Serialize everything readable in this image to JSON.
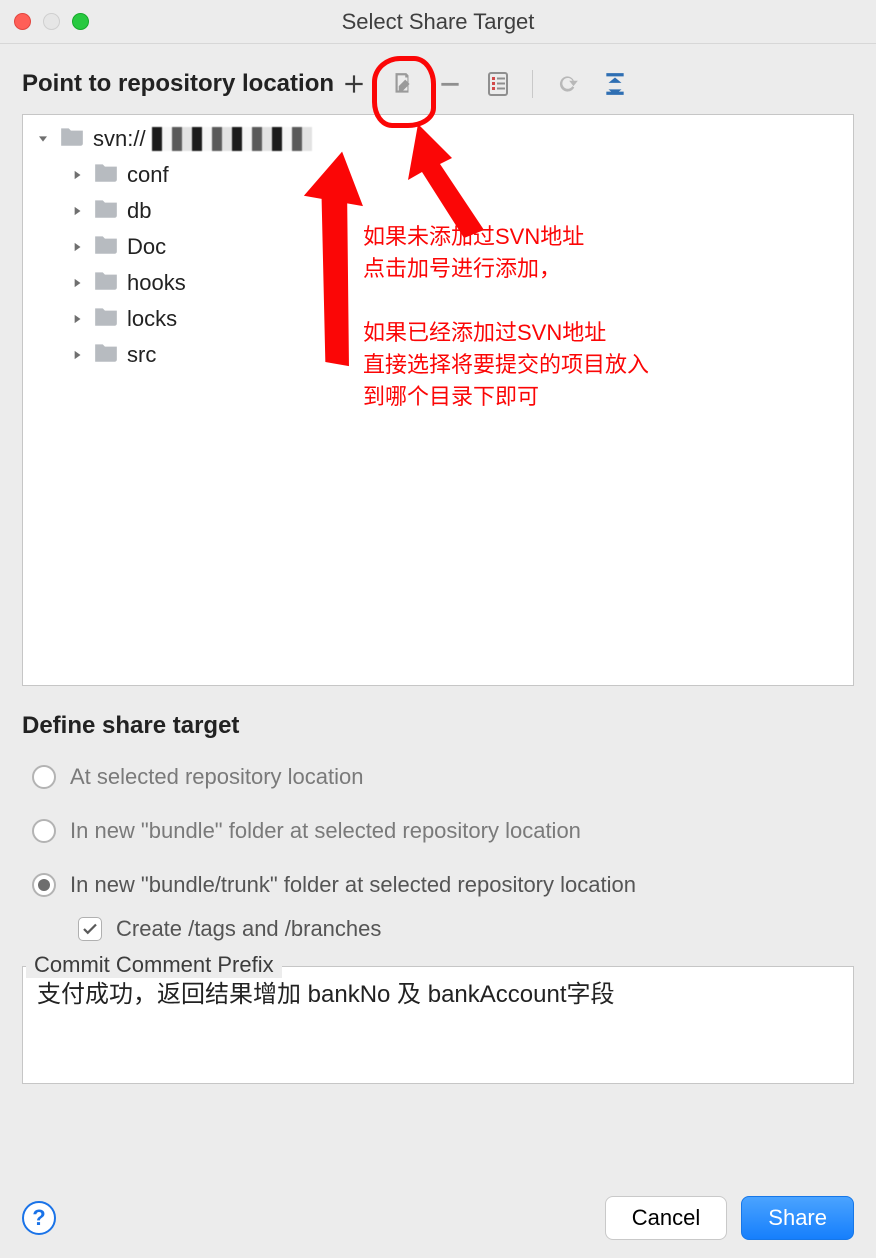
{
  "window": {
    "title": "Select Share Target"
  },
  "heading": "Point to repository location",
  "toolbar": {
    "add": "add-icon",
    "edit": "edit-icon",
    "remove": "remove-icon",
    "checklist": "checklist-icon",
    "refresh": "refresh-icon",
    "collapse": "collapse-icon"
  },
  "tree": {
    "root": {
      "label_prefix": "svn://"
    },
    "children": [
      {
        "label": "conf"
      },
      {
        "label": "db"
      },
      {
        "label": "Doc"
      },
      {
        "label": "hooks"
      },
      {
        "label": "locks"
      },
      {
        "label": "src"
      }
    ]
  },
  "annotations": {
    "block1_line1": "如果未添加过SVN地址",
    "block1_line2": "点击加号进行添加，",
    "block2_line1": "如果已经添加过SVN地址",
    "block2_line2": "直接选择将要提交的项目放入",
    "block2_line3": "到哪个目录下即可"
  },
  "define": {
    "heading": "Define share target",
    "opts": [
      "At selected repository location",
      "In new \"bundle\" folder at selected repository location",
      "In new \"bundle/trunk\" folder at selected repository location"
    ],
    "checkbox": "Create /tags and /branches"
  },
  "comment": {
    "label": "Commit Comment Prefix",
    "value": "支付成功，返回结果增加 bankNo 及 bankAccount字段"
  },
  "actions": {
    "cancel": "Cancel",
    "share": "Share"
  }
}
